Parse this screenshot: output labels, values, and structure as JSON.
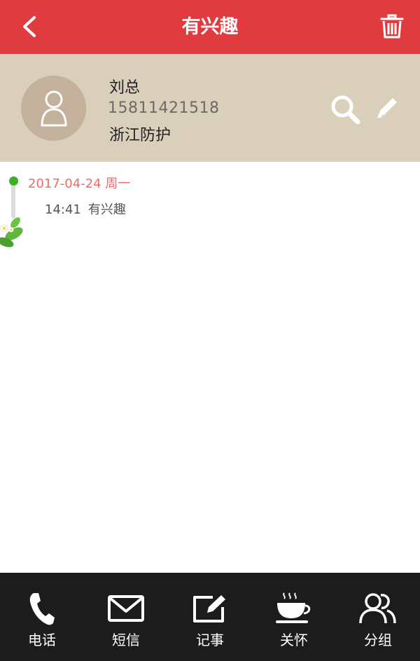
{
  "header": {
    "title": "有兴趣",
    "back_icon": "chevron-left-icon",
    "delete_icon": "trash-icon",
    "color": "#e03b3e"
  },
  "profile": {
    "name": "刘总",
    "phone": "15811421518",
    "company": "浙江防护",
    "avatar_icon": "person-icon",
    "search_icon": "search-icon",
    "edit_icon": "pencil-icon",
    "background": "#d9cfbb"
  },
  "timeline": {
    "date": "2017-04-24 周一",
    "entries": [
      {
        "time": "14:41",
        "text": "有兴趣"
      }
    ],
    "dot_color": "#3bb024",
    "date_color": "#ea6d6a"
  },
  "bottom_nav": {
    "items": [
      {
        "label": "电话",
        "icon": "phone-icon"
      },
      {
        "label": "短信",
        "icon": "envelope-icon"
      },
      {
        "label": "记事",
        "icon": "note-edit-icon"
      },
      {
        "label": "关怀",
        "icon": "coffee-cup-icon"
      },
      {
        "label": "分组",
        "icon": "group-icon"
      }
    ]
  }
}
